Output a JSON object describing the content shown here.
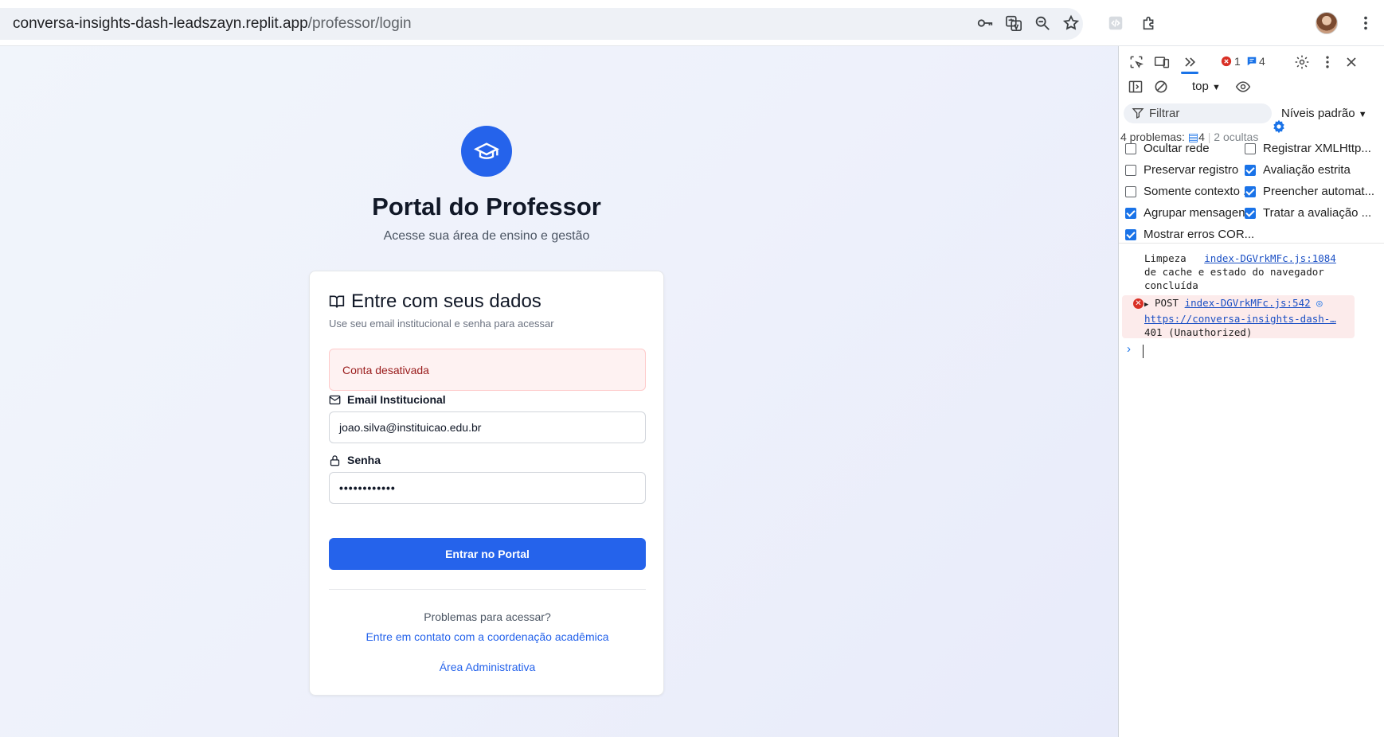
{
  "browser": {
    "url_host": "conversa-insights-dash-leadszayn.replit.app",
    "url_path": "/professor/login",
    "toolbar_icons": [
      "key-icon",
      "translate-icon",
      "zoom-icon",
      "star-icon",
      "devtools-extension-icon",
      "extensions-icon",
      "profile-avatar",
      "menu-icon"
    ]
  },
  "page": {
    "title": "Portal do Professor",
    "subtitle": "Acesse sua área de ensino e gestão",
    "logo_icon": "graduation-cap-icon",
    "card": {
      "title": "Entre com seus dados",
      "description": "Use seu email institucional e senha para acessar",
      "alert": "Conta desativada",
      "email_label": "Email Institucional",
      "email_value": "joao.silva@instituicao.edu.br",
      "password_label": "Senha",
      "password_value": "••••••••••••",
      "submit_label": "Entrar no Portal",
      "help_text": "Problemas para acessar?",
      "help_link": "Entre em contato com a coordenação acadêmica",
      "admin_link": "Área Administrativa"
    },
    "colors": {
      "primary": "#2563eb",
      "alert_bg": "#fef2f2",
      "alert_text": "#991b1b"
    }
  },
  "devtools": {
    "error_count": "1",
    "message_count": "4",
    "context": "top",
    "filter_placeholder": "Filtrar",
    "levels": "Níveis padrão",
    "problems_label": "4 problemas:",
    "problems_count": "4",
    "hidden_label": "2 ocultas",
    "checkboxes_left": [
      {
        "label": "Ocultar rede",
        "checked": false
      },
      {
        "label": "Preservar registro",
        "checked": false
      },
      {
        "label": "Somente contexto ...",
        "checked": false
      },
      {
        "label": "Agrupar mensagen...",
        "checked": true
      },
      {
        "label": "Mostrar erros COR...",
        "checked": true
      }
    ],
    "checkboxes_right": [
      {
        "label": "Registrar XMLHttp...",
        "checked": false
      },
      {
        "label": "Avaliação estrita",
        "checked": true
      },
      {
        "label": "Preencher automat...",
        "checked": true
      },
      {
        "label": "Tratar a avaliação ...",
        "checked": true
      }
    ],
    "log_info": {
      "text_1": "Limpeza",
      "source": "index-DGVrkMFc.js:1084",
      "text_2": "de cache e estado do navegador",
      "text_3": "concluída"
    },
    "log_error": {
      "method": "POST",
      "source": "index-DGVrkMFc.js:542",
      "url": "https://conversa-insights-dash-…",
      "status": "401 (Unauthorized)"
    }
  }
}
